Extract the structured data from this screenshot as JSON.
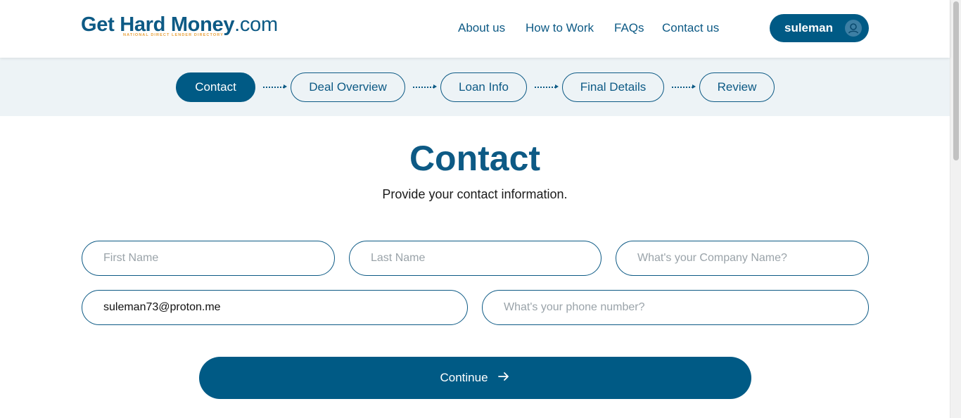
{
  "header": {
    "logo": {
      "main": "Get Hard Money",
      "suffix": ".com",
      "tagline": "NATIONAL DIRECT LENDER DIRECTORY"
    },
    "nav": [
      "About us",
      "How to Work",
      "FAQs",
      "Contact us"
    ],
    "user": {
      "name": "suleman"
    }
  },
  "stepper": {
    "steps": [
      "Contact",
      "Deal Overview",
      "Loan Info",
      "Final Details",
      "Review"
    ],
    "active": "Contact"
  },
  "main": {
    "title": "Contact",
    "subtitle": "Provide your contact information.",
    "fields": {
      "first_name": {
        "placeholder": "First Name",
        "value": ""
      },
      "last_name": {
        "placeholder": "Last Name",
        "value": ""
      },
      "company": {
        "placeholder": "What's your Company Name?",
        "value": ""
      },
      "email": {
        "placeholder": "",
        "value": "suleman73@proton.me"
      },
      "phone": {
        "placeholder": "What's your phone number?",
        "value": ""
      }
    },
    "continue_label": "Continue"
  },
  "colors": {
    "brand": "#005a85",
    "accent": "#e8a03a",
    "band": "#edf3f6"
  }
}
